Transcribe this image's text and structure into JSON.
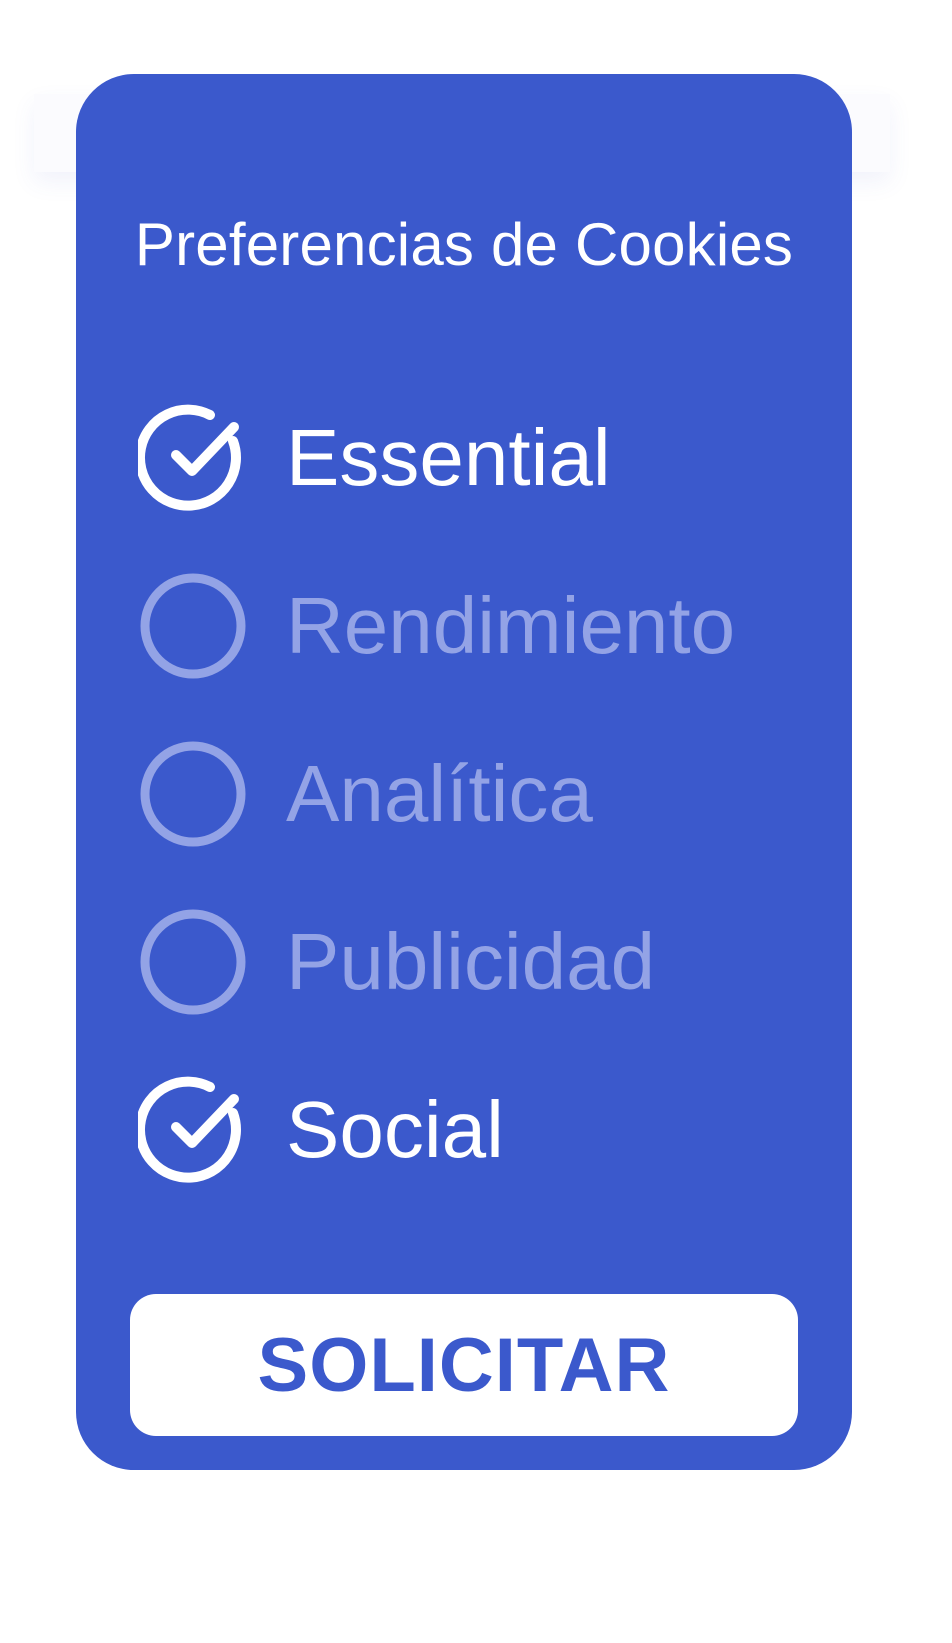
{
  "dialog": {
    "title": "Preferencias de Cookies",
    "options": [
      {
        "label": "Essential",
        "checked": true,
        "icon": "check-circle-icon"
      },
      {
        "label": "Rendimiento",
        "checked": false,
        "icon": "empty-circle-icon"
      },
      {
        "label": "Analítica",
        "checked": false,
        "icon": "empty-circle-icon"
      },
      {
        "label": "Publicidad",
        "checked": false,
        "icon": "empty-circle-icon"
      },
      {
        "label": "Social",
        "checked": true,
        "icon": "check-circle-icon"
      }
    ],
    "apply_label": "SOLICITAR"
  },
  "colors": {
    "panel": "#3b59cc",
    "checked_text": "#ffffff",
    "unchecked_text": "#93a3e6",
    "button_bg": "#ffffff",
    "button_text": "#3b59cc"
  }
}
